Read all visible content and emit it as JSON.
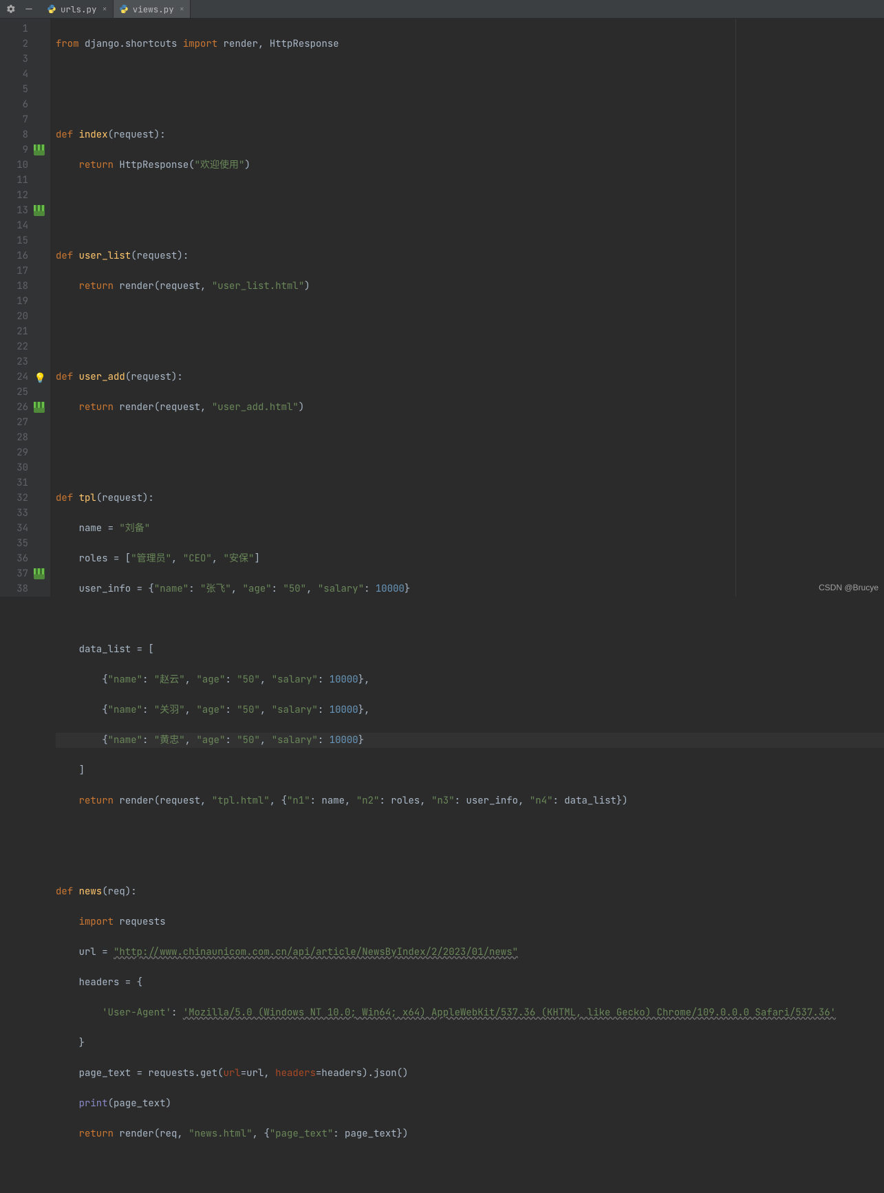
{
  "tabs": [
    {
      "label": "urls.py",
      "active": false
    },
    {
      "label": "views.py",
      "active": true
    }
  ],
  "line_numbers": [
    "1",
    "2",
    "3",
    "4",
    "5",
    "6",
    "7",
    "8",
    "9",
    "10",
    "11",
    "12",
    "13",
    "14",
    "15",
    "16",
    "17",
    "18",
    "19",
    "20",
    "21",
    "22",
    "23",
    "24",
    "25",
    "26",
    "27",
    "28",
    "29",
    "30",
    "31",
    "32",
    "33",
    "34",
    "35",
    "36",
    "37",
    "38"
  ],
  "watermark": "CSDN @Brucye",
  "code": {
    "l1_from": "from",
    "l1_mod": "django.shortcuts",
    "l1_import": "import",
    "l1_names": "render, HttpResponse",
    "l4_def": "def ",
    "l4_fn": "index",
    "l4_sig": "(request):",
    "l5_ret": "return ",
    "l5_call": "HttpResponse(",
    "l5_str": "\"欢迎使用\"",
    "l5_end": ")",
    "l8_def": "def ",
    "l8_fn": "user_list",
    "l8_sig": "(request):",
    "l9_ret": "return ",
    "l9_call": "render(request, ",
    "l9_str": "\"user_list.html\"",
    "l9_end": ")",
    "l12_def": "def ",
    "l12_fn": "user_add",
    "l12_sig": "(request):",
    "l13_ret": "return ",
    "l13_call": "render(request, ",
    "l13_str": "\"user_add.html\"",
    "l13_end": ")",
    "l16_def": "def ",
    "l16_fn": "tpl",
    "l16_sig": "(request):",
    "l17": "    name = ",
    "l17_str": "\"刘备\"",
    "l18": "    roles = [",
    "l18_s1": "\"管理员\"",
    "l18_c1": ", ",
    "l18_s2": "\"CEO\"",
    "l18_c2": ", ",
    "l18_s3": "\"安保\"",
    "l18_end": "]",
    "l19": "    user_info = {",
    "l19_k1": "\"name\"",
    "l19_c1": ": ",
    "l19_v1": "\"张飞\"",
    "l19_c2": ", ",
    "l19_k2": "\"age\"",
    "l19_c3": ": ",
    "l19_v2": "\"50\"",
    "l19_c4": ", ",
    "l19_k3": "\"salary\"",
    "l19_c5": ": ",
    "l19_num": "10000",
    "l19_end": "}",
    "l21": "    data_list = [",
    "l22": "        {",
    "l22_k1": "\"name\"",
    "l22_c1": ": ",
    "l22_v1": "\"赵云\"",
    "l22_c2": ", ",
    "l22_k2": "\"age\"",
    "l22_c3": ": ",
    "l22_v2": "\"50\"",
    "l22_c4": ", ",
    "l22_k3": "\"salary\"",
    "l22_c5": ": ",
    "l22_num": "10000",
    "l22_end": "},",
    "l23": "        {",
    "l23_k1": "\"name\"",
    "l23_c1": ": ",
    "l23_v1": "\"关羽\"",
    "l23_c2": ", ",
    "l23_k2": "\"age\"",
    "l23_c3": ": ",
    "l23_v2": "\"50\"",
    "l23_c4": ", ",
    "l23_k3": "\"salary\"",
    "l23_c5": ": ",
    "l23_num": "10000",
    "l23_end": "},",
    "l24": "        {",
    "l24_k1": "\"name\"",
    "l24_c1": ": ",
    "l24_v1": "\"黄忠\"",
    "l24_c2": ", ",
    "l24_k2": "\"age\"",
    "l24_c3": ": ",
    "l24_v2": "\"50\"",
    "l24_c4": ", ",
    "l24_k3": "\"salary\"",
    "l24_c5": ": ",
    "l24_num": "10000",
    "l24_end": "}",
    "l25": "    ]",
    "l26_ret": "return ",
    "l26_call": "render(request, ",
    "l26_str": "\"tpl.html\"",
    "l26_mid": ", {",
    "l26_k1": "\"n1\"",
    "l26_c1": ": name, ",
    "l26_k2": "\"n2\"",
    "l26_c2": ": roles, ",
    "l26_k3": "\"n3\"",
    "l26_c3": ": user_info, ",
    "l26_k4": "\"n4\"",
    "l26_c4": ": data_list})",
    "l29_def": "def ",
    "l29_fn": "news",
    "l29_sig": "(req):",
    "l30_imp": "import ",
    "l30_mod": "requests",
    "l31": "    url = ",
    "l31_url": "\"http://www.chinaunicom.com.cn/api/article/NewsByIndex/2/2023/01/news\"",
    "l32": "    headers = {",
    "l33": "        ",
    "l33_k": "'User-Agent'",
    "l33_c": ": ",
    "l33_v": "'Mozilla/5.0 (Windows NT 10.0; Win64; x64) AppleWebKit/537.36 (KHTML, like Gecko) Chrome/109.0.0.0 Safari/537.36'",
    "l34": "    }",
    "l35": "    page_text = requests.get(",
    "l35_p1": "url",
    "l35_e1": "=url, ",
    "l35_p2": "headers",
    "l35_e2": "=headers).json()",
    "l36_print": "print",
    "l36_sig": "(page_text)",
    "l37_ret": "return ",
    "l37_call": "render(req, ",
    "l37_str": "\"news.html\"",
    "l37_mid": ", {",
    "l37_k": "\"page_text\"",
    "l37_end": ": page_text})"
  }
}
